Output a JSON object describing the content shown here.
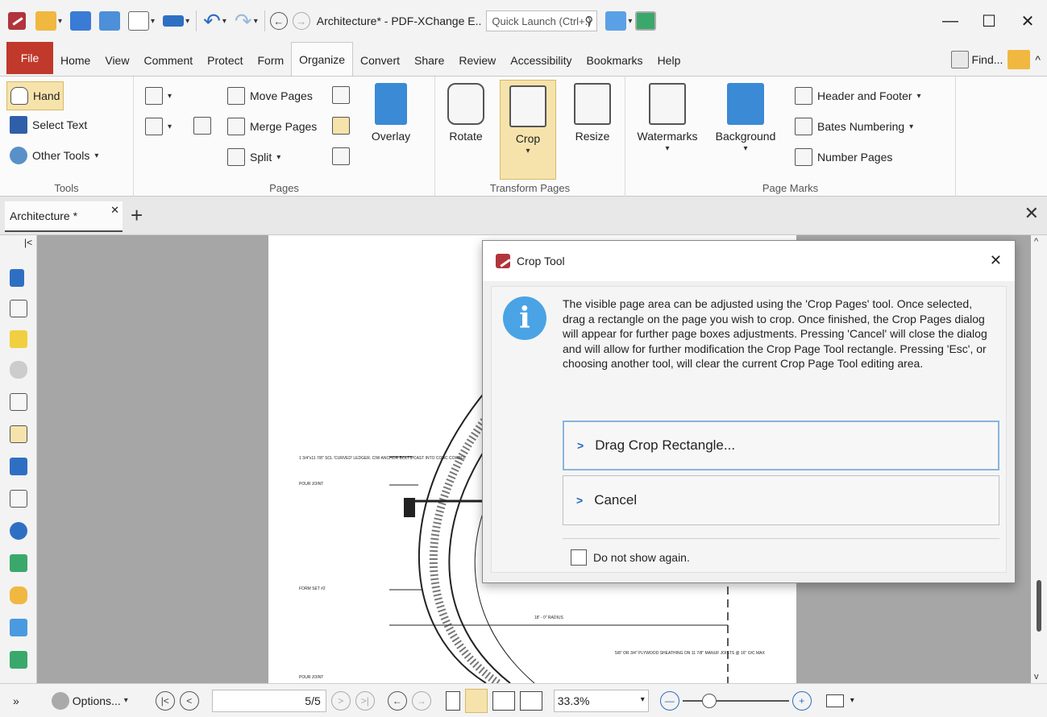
{
  "window": {
    "title": "Architecture* - PDF-XChange E..",
    "quick_launch_placeholder": "Quick Launch (Ctrl+.)"
  },
  "menu": {
    "file": "File",
    "tabs": [
      "Home",
      "View",
      "Comment",
      "Protect",
      "Form",
      "Organize",
      "Convert",
      "Share",
      "Review",
      "Accessibility",
      "Bookmarks",
      "Help"
    ],
    "active_tab": "Organize",
    "find": "Find..."
  },
  "ribbon": {
    "tools": {
      "label": "Tools",
      "hand": "Hand",
      "select_text": "Select Text",
      "other_tools": "Other Tools"
    },
    "pages": {
      "label": "Pages",
      "move_pages": "Move Pages",
      "merge_pages": "Merge Pages",
      "split": "Split",
      "overlay": "Overlay"
    },
    "transform": {
      "label": "Transform Pages",
      "rotate": "Rotate",
      "crop": "Crop",
      "resize": "Resize"
    },
    "page_marks": {
      "label": "Page Marks",
      "watermarks": "Watermarks",
      "background": "Background",
      "header_footer": "Header and Footer",
      "bates": "Bates Numbering",
      "number_pages": "Number Pages"
    }
  },
  "doc_tab": {
    "name": "Architecture *"
  },
  "dialog": {
    "title": "Crop Tool",
    "message": "The visible page area can be adjusted using the 'Crop Pages' tool. Once selected, drag a rectangle on the page you wish to crop. Once finished, the Crop Pages dialog will appear for further page boxes adjustments. Pressing 'Cancel' will close the dialog and will allow for further modification the Crop Page Tool rectangle. Pressing 'Esc', or choosing another tool, will clear the current Crop Page Tool editing area.",
    "drag_button": "Drag Crop Rectangle...",
    "cancel_button": "Cancel",
    "checkbox": "Do not show again."
  },
  "drawing_labels": {
    "a": "1 3/4\"x11 7/8\" SCL 'CURVED' LEDGER. CIW ANCHOR BOLTS CAST INTO CONC CORBEL",
    "b": "POUR JOINT",
    "c": "FORM SET #2",
    "d": "18' - 0\" RADIUS",
    "e": "5/8\" OR 3/4\" PLYWOOD SHEATHING ON 11 7/8\" MANUF JOISTS @ 16\" O/C MAX",
    "f": "POUR JOINT"
  },
  "status": {
    "options": "Options...",
    "page_current": "5",
    "page_total": "5",
    "zoom": "33.3%"
  }
}
